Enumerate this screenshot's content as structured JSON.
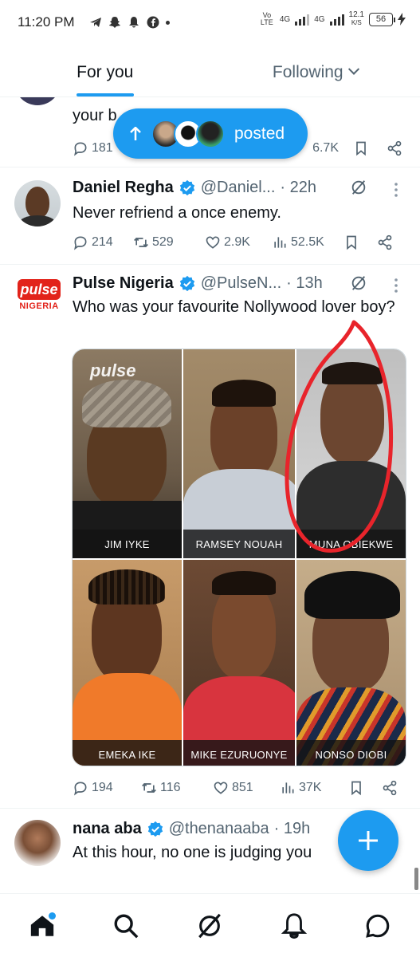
{
  "status_bar": {
    "time": "11:20 PM",
    "net_label": "Vo LTE",
    "net1": "4G",
    "net2": "4G",
    "speed": "12.1",
    "speed_unit": "K/S",
    "battery": "56"
  },
  "tabs": {
    "for_you": "For you",
    "following": "Following"
  },
  "partial_tweet": {
    "text_fragment": "your b",
    "replies": "181",
    "views": "6.7K"
  },
  "posted_pill": {
    "label": "posted"
  },
  "tweets": [
    {
      "name": "Daniel Regha",
      "handle": "@Daniel...",
      "time": "· 22h",
      "text": "Never refriend a once enemy.",
      "replies": "214",
      "reposts": "529",
      "likes": "2.9K",
      "views": "52.5K"
    },
    {
      "name": "Pulse Nigeria",
      "handle": "@PulseN...",
      "time": "· 13h",
      "text": "Who was your favourite Nollywood lover boy?",
      "avatar_text": "pulse",
      "avatar_sub": "NIGERIA",
      "image_watermark": "pulse",
      "captions": [
        "JIM IYKE",
        "RAMSEY NOUAH",
        "MUNA OBIEKWE",
        "EMEKA IKE",
        "MIKE EZURUONYE",
        "NONSO DIOBI"
      ],
      "replies": "194",
      "reposts": "116",
      "likes": "851",
      "views": "37K"
    },
    {
      "name": "nana aba",
      "handle": "@thenanaaba",
      "time": "· 19h",
      "text": "At this hour, no one is judging you"
    }
  ],
  "colors": {
    "accent": "#1d9bf0",
    "annotation": "#e8242b"
  }
}
